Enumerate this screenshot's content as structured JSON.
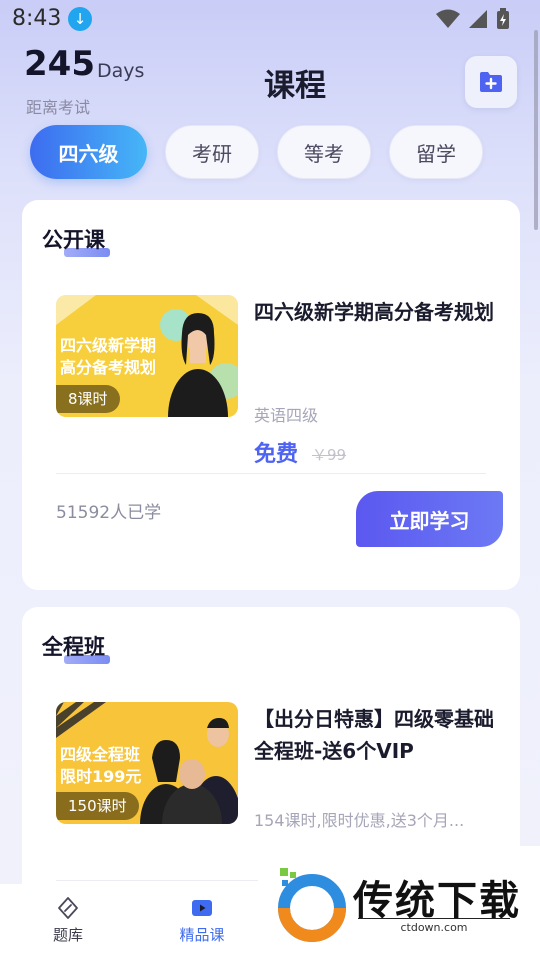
{
  "status_bar": {
    "time": "8:43",
    "download_icon": "download-arrow-icon"
  },
  "header": {
    "days_count": "245",
    "days_unit": "Days",
    "days_caption": "距离考试",
    "title": "课程",
    "add_icon": "calendar-plus-icon"
  },
  "tabs": [
    {
      "label": "四六级",
      "active": true
    },
    {
      "label": "考研",
      "active": false
    },
    {
      "label": "等考",
      "active": false
    },
    {
      "label": "留学",
      "active": false
    }
  ],
  "sections": [
    {
      "title": "公开课",
      "course": {
        "thumb_text": [
          "四六级新学期",
          "高分备考规划"
        ],
        "lesson_badge": "8课时",
        "title": "四六级新学期高分备考规划",
        "subtitle": "英语四级",
        "price": "免费",
        "original_price": "￥99",
        "learners": "51592人已学",
        "cta_label": "立即学习"
      }
    },
    {
      "title": "全程班",
      "course": {
        "thumb_text": [
          "四级全程班",
          "限时199元"
        ],
        "lesson_badge": "150课时",
        "title": "【出分日特惠】四级零基础全程班-送6个VIP",
        "subtitle": "154课时,限时优惠,送3个月..."
      }
    }
  ],
  "bottom_nav": [
    {
      "label": "题库",
      "icon": "edit-diamond-icon",
      "active": false
    },
    {
      "label": "精品课",
      "icon": "video-play-icon",
      "active": true
    }
  ],
  "watermark": {
    "brand": "传统下载",
    "url": "ctdown.com"
  },
  "colors": {
    "accent": "#4f63f2",
    "tab_active_start": "#3d6cf0",
    "tab_active_end": "#46b6f7",
    "cta": "#5b58f0"
  }
}
